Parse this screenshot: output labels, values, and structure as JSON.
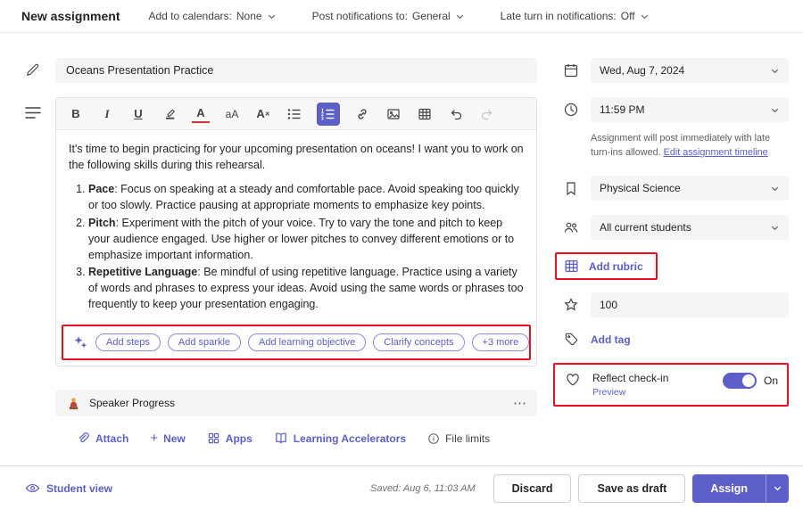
{
  "colors": {
    "accent": "#5b5fc7",
    "annotation_red": "#e81123",
    "input_bg": "#f5f5f5",
    "toggle_on": "#5b5fc7"
  },
  "icons": {
    "bold": "B",
    "italic": "I",
    "underline": "U",
    "font_color": "A",
    "font_size": "aA",
    "clear_format": "A",
    "clear_format_x": "✕",
    "plus": "+",
    "ellipsis": "⋯"
  },
  "header": {
    "title": "New assignment",
    "menus": [
      {
        "label": "Add to calendars:",
        "value": "None"
      },
      {
        "label": "Post notifications to:",
        "value": "General"
      },
      {
        "label": "Late turn in notifications:",
        "value": "Off"
      }
    ]
  },
  "assignment": {
    "title": "Oceans Presentation Practice",
    "instructions_intro": "It's time to begin practicing for your upcoming presentation on oceans! I want you to work on the following skills during this rehearsal.",
    "skills": [
      {
        "term": "Pace",
        "text": ": Focus on speaking at a steady and comfortable pace. Avoid speaking too quickly or too slowly. Practice pausing at appropriate moments to emphasize key points."
      },
      {
        "term": "Pitch",
        "text": ": Experiment with the pitch of your voice. Try to vary the tone and pitch to keep your audience engaged. Use higher or lower pitches to convey different emotions or to emphasize important information."
      },
      {
        "term": "Repetitive Language",
        "text": ": Be mindful of using repetitive language. Practice using a variety of words and phrases to express your ideas. Avoid using the same words or phrases too frequently to keep your presentation engaging."
      }
    ],
    "ai_pills": [
      "Add steps",
      "Add sparkle",
      "Add learning objective",
      "Clarify concepts",
      "+3 more"
    ],
    "attachment_name": "Speaker Progress",
    "actions": {
      "attach": "Attach",
      "new": "New",
      "apps": "Apps",
      "learning_accelerators": "Learning Accelerators",
      "file_limits": "File limits"
    }
  },
  "sidebar": {
    "due_date": "Wed, Aug 7, 2024",
    "due_time": "11:59 PM",
    "post_note": "Assignment will post immediately with late turn-ins allowed.",
    "post_note_link": "Edit assignment timeline",
    "class_name": "Physical Science",
    "students": "All current students",
    "add_rubric": "Add rubric",
    "points": "100",
    "add_tag": "Add tag",
    "reflect": {
      "label": "Reflect check-in",
      "preview": "Preview",
      "state": "On"
    }
  },
  "footer": {
    "student_view": "Student view",
    "saved": "Saved: Aug 6, 11:03 AM",
    "discard": "Discard",
    "save_draft": "Save as draft",
    "assign": "Assign"
  }
}
